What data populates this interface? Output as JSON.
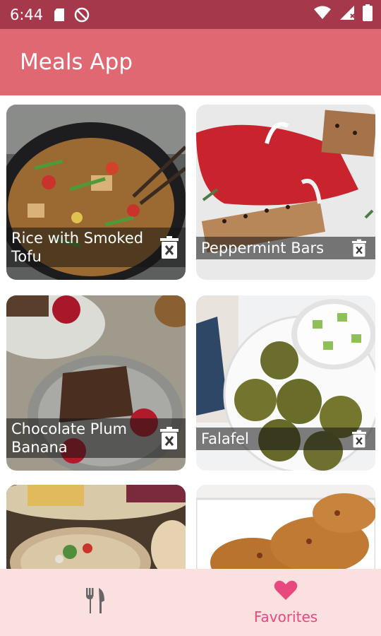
{
  "status_bar": {
    "time": "6:44",
    "icons": [
      "sd-card-icon",
      "do-not-disturb-icon",
      "wifi-icon",
      "signal-icon",
      "battery-icon"
    ]
  },
  "app_bar": {
    "title": "Meals App"
  },
  "meals": [
    {
      "title": "Rice with Smoked Tofu",
      "action_icon": "delete-icon"
    },
    {
      "title": "Peppermint Bars",
      "action_icon": "delete-icon"
    },
    {
      "title": "Chocolate Plum Banana",
      "action_icon": "delete-icon"
    },
    {
      "title": "Falafel",
      "action_icon": "delete-icon"
    },
    {
      "title": "",
      "action_icon": ""
    },
    {
      "title": "",
      "action_icon": ""
    }
  ],
  "bottom_nav": {
    "items": [
      {
        "icon": "fork-knife-icon",
        "label": ""
      },
      {
        "icon": "heart-icon",
        "label": "Favorites",
        "active": true
      }
    ]
  },
  "colors": {
    "status_bar": "#a5384a",
    "app_bar": "#e06873",
    "bottom_nav": "#fbe0e0",
    "accent": "#e7497e"
  }
}
